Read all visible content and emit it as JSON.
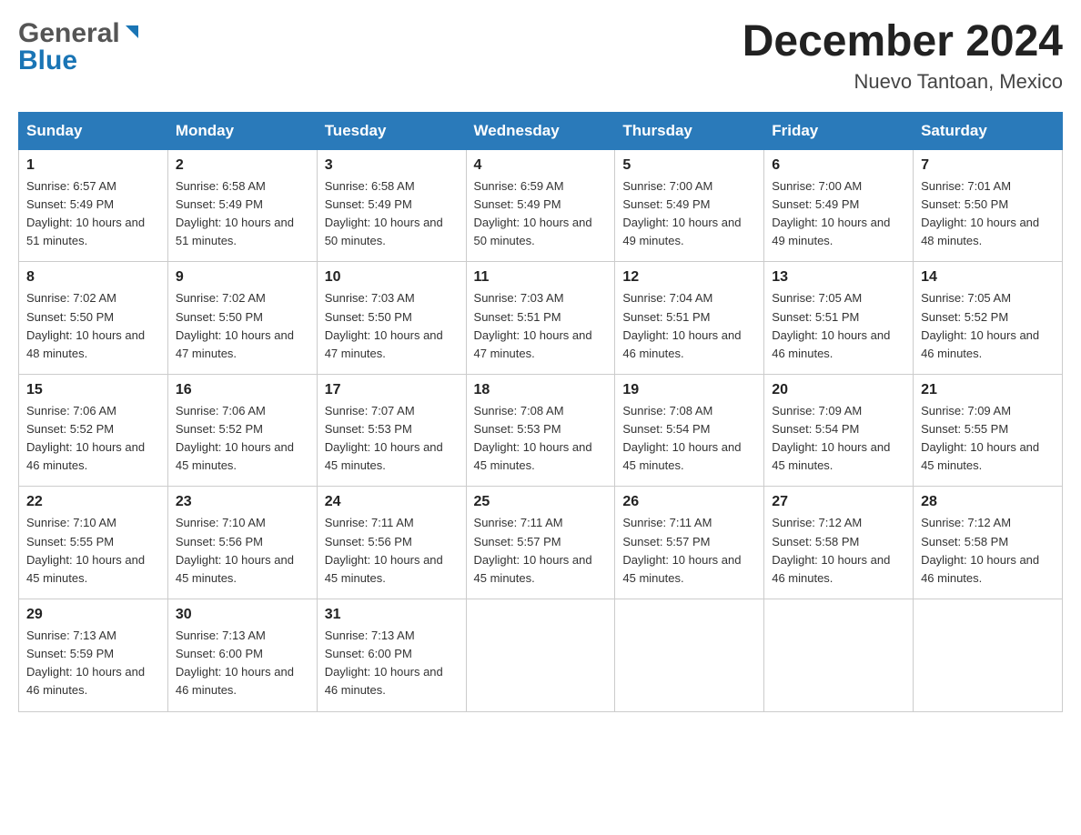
{
  "header": {
    "logo_general": "General",
    "logo_blue": "Blue",
    "month_title": "December 2024",
    "location": "Nuevo Tantoan, Mexico"
  },
  "calendar": {
    "days_of_week": [
      "Sunday",
      "Monday",
      "Tuesday",
      "Wednesday",
      "Thursday",
      "Friday",
      "Saturday"
    ],
    "weeks": [
      [
        {
          "day": "1",
          "sunrise": "Sunrise: 6:57 AM",
          "sunset": "Sunset: 5:49 PM",
          "daylight": "Daylight: 10 hours and 51 minutes."
        },
        {
          "day": "2",
          "sunrise": "Sunrise: 6:58 AM",
          "sunset": "Sunset: 5:49 PM",
          "daylight": "Daylight: 10 hours and 51 minutes."
        },
        {
          "day": "3",
          "sunrise": "Sunrise: 6:58 AM",
          "sunset": "Sunset: 5:49 PM",
          "daylight": "Daylight: 10 hours and 50 minutes."
        },
        {
          "day": "4",
          "sunrise": "Sunrise: 6:59 AM",
          "sunset": "Sunset: 5:49 PM",
          "daylight": "Daylight: 10 hours and 50 minutes."
        },
        {
          "day": "5",
          "sunrise": "Sunrise: 7:00 AM",
          "sunset": "Sunset: 5:49 PM",
          "daylight": "Daylight: 10 hours and 49 minutes."
        },
        {
          "day": "6",
          "sunrise": "Sunrise: 7:00 AM",
          "sunset": "Sunset: 5:49 PM",
          "daylight": "Daylight: 10 hours and 49 minutes."
        },
        {
          "day": "7",
          "sunrise": "Sunrise: 7:01 AM",
          "sunset": "Sunset: 5:50 PM",
          "daylight": "Daylight: 10 hours and 48 minutes."
        }
      ],
      [
        {
          "day": "8",
          "sunrise": "Sunrise: 7:02 AM",
          "sunset": "Sunset: 5:50 PM",
          "daylight": "Daylight: 10 hours and 48 minutes."
        },
        {
          "day": "9",
          "sunrise": "Sunrise: 7:02 AM",
          "sunset": "Sunset: 5:50 PM",
          "daylight": "Daylight: 10 hours and 47 minutes."
        },
        {
          "day": "10",
          "sunrise": "Sunrise: 7:03 AM",
          "sunset": "Sunset: 5:50 PM",
          "daylight": "Daylight: 10 hours and 47 minutes."
        },
        {
          "day": "11",
          "sunrise": "Sunrise: 7:03 AM",
          "sunset": "Sunset: 5:51 PM",
          "daylight": "Daylight: 10 hours and 47 minutes."
        },
        {
          "day": "12",
          "sunrise": "Sunrise: 7:04 AM",
          "sunset": "Sunset: 5:51 PM",
          "daylight": "Daylight: 10 hours and 46 minutes."
        },
        {
          "day": "13",
          "sunrise": "Sunrise: 7:05 AM",
          "sunset": "Sunset: 5:51 PM",
          "daylight": "Daylight: 10 hours and 46 minutes."
        },
        {
          "day": "14",
          "sunrise": "Sunrise: 7:05 AM",
          "sunset": "Sunset: 5:52 PM",
          "daylight": "Daylight: 10 hours and 46 minutes."
        }
      ],
      [
        {
          "day": "15",
          "sunrise": "Sunrise: 7:06 AM",
          "sunset": "Sunset: 5:52 PM",
          "daylight": "Daylight: 10 hours and 46 minutes."
        },
        {
          "day": "16",
          "sunrise": "Sunrise: 7:06 AM",
          "sunset": "Sunset: 5:52 PM",
          "daylight": "Daylight: 10 hours and 45 minutes."
        },
        {
          "day": "17",
          "sunrise": "Sunrise: 7:07 AM",
          "sunset": "Sunset: 5:53 PM",
          "daylight": "Daylight: 10 hours and 45 minutes."
        },
        {
          "day": "18",
          "sunrise": "Sunrise: 7:08 AM",
          "sunset": "Sunset: 5:53 PM",
          "daylight": "Daylight: 10 hours and 45 minutes."
        },
        {
          "day": "19",
          "sunrise": "Sunrise: 7:08 AM",
          "sunset": "Sunset: 5:54 PM",
          "daylight": "Daylight: 10 hours and 45 minutes."
        },
        {
          "day": "20",
          "sunrise": "Sunrise: 7:09 AM",
          "sunset": "Sunset: 5:54 PM",
          "daylight": "Daylight: 10 hours and 45 minutes."
        },
        {
          "day": "21",
          "sunrise": "Sunrise: 7:09 AM",
          "sunset": "Sunset: 5:55 PM",
          "daylight": "Daylight: 10 hours and 45 minutes."
        }
      ],
      [
        {
          "day": "22",
          "sunrise": "Sunrise: 7:10 AM",
          "sunset": "Sunset: 5:55 PM",
          "daylight": "Daylight: 10 hours and 45 minutes."
        },
        {
          "day": "23",
          "sunrise": "Sunrise: 7:10 AM",
          "sunset": "Sunset: 5:56 PM",
          "daylight": "Daylight: 10 hours and 45 minutes."
        },
        {
          "day": "24",
          "sunrise": "Sunrise: 7:11 AM",
          "sunset": "Sunset: 5:56 PM",
          "daylight": "Daylight: 10 hours and 45 minutes."
        },
        {
          "day": "25",
          "sunrise": "Sunrise: 7:11 AM",
          "sunset": "Sunset: 5:57 PM",
          "daylight": "Daylight: 10 hours and 45 minutes."
        },
        {
          "day": "26",
          "sunrise": "Sunrise: 7:11 AM",
          "sunset": "Sunset: 5:57 PM",
          "daylight": "Daylight: 10 hours and 45 minutes."
        },
        {
          "day": "27",
          "sunrise": "Sunrise: 7:12 AM",
          "sunset": "Sunset: 5:58 PM",
          "daylight": "Daylight: 10 hours and 46 minutes."
        },
        {
          "day": "28",
          "sunrise": "Sunrise: 7:12 AM",
          "sunset": "Sunset: 5:58 PM",
          "daylight": "Daylight: 10 hours and 46 minutes."
        }
      ],
      [
        {
          "day": "29",
          "sunrise": "Sunrise: 7:13 AM",
          "sunset": "Sunset: 5:59 PM",
          "daylight": "Daylight: 10 hours and 46 minutes."
        },
        {
          "day": "30",
          "sunrise": "Sunrise: 7:13 AM",
          "sunset": "Sunset: 6:00 PM",
          "daylight": "Daylight: 10 hours and 46 minutes."
        },
        {
          "day": "31",
          "sunrise": "Sunrise: 7:13 AM",
          "sunset": "Sunset: 6:00 PM",
          "daylight": "Daylight: 10 hours and 46 minutes."
        },
        null,
        null,
        null,
        null
      ]
    ]
  }
}
